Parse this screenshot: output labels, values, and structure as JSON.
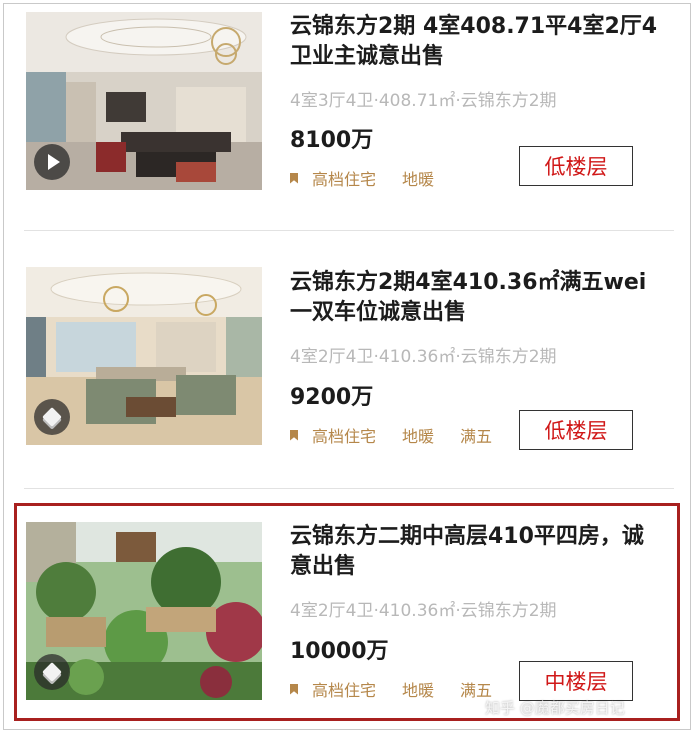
{
  "listings": [
    {
      "title": "云锦东方2期 4室408.71平4室2厅4卫业主诚意出售",
      "details": "4室3厅4卫·408.71㎡·云锦东方2期",
      "price": "8100万",
      "tags": [
        "高档住宅",
        "地暖"
      ],
      "floor_label": "低楼层",
      "media_icon": "play-icon"
    },
    {
      "title": "云锦东方2期4室410.36㎡满五wei一双车位诚意出售",
      "details": "4室2厅4卫·410.36㎡·云锦东方2期",
      "price": "9200万",
      "tags": [
        "高档住宅",
        "地暖",
        "满五"
      ],
      "floor_label": "低楼层",
      "media_icon": "vr-icon"
    },
    {
      "title": "云锦东方二期中高层410平四房，诚意出售",
      "details": "4室2厅4卫·410.36㎡·云锦东方2期",
      "price": "10000万",
      "tags": [
        "高档住宅",
        "地暖",
        "满五"
      ],
      "floor_label": "中楼层",
      "media_icon": "vr-icon"
    }
  ],
  "watermark": "知乎 @魔都买房日记",
  "colors": {
    "tag": "#b5874a",
    "floor_text": "#d01818",
    "highlight_border": "#a8201f"
  }
}
